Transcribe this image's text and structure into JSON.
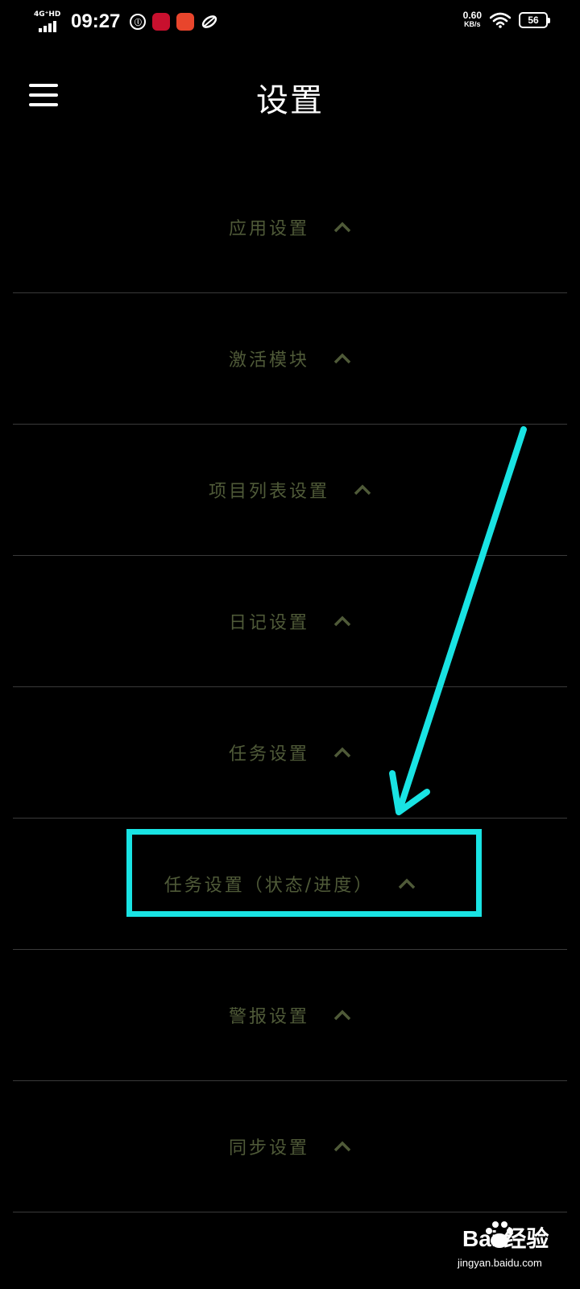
{
  "status_bar": {
    "network_label": "4G⁺HD",
    "time": "09:27",
    "speed_value": "0.60",
    "speed_unit": "KB/s",
    "battery": "56"
  },
  "header": {
    "title": "设置"
  },
  "settings": [
    {
      "label": "应用设置"
    },
    {
      "label": "激活模块"
    },
    {
      "label": "项目列表设置"
    },
    {
      "label": "日记设置"
    },
    {
      "label": "任务设置"
    },
    {
      "label": "任务设置（状态/进度）"
    },
    {
      "label": "警报设置"
    },
    {
      "label": "同步设置"
    }
  ],
  "watermark": {
    "brand": "Bai 经验",
    "url": "jingyan.baidu.com"
  },
  "colors": {
    "background": "#000000",
    "label": "#4f5a38",
    "divider": "#3a3a3a",
    "annotation": "#19e3e3"
  }
}
